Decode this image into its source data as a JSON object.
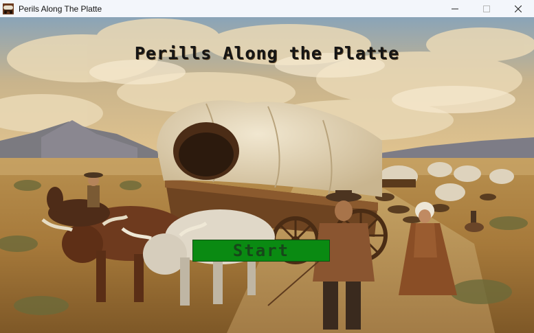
{
  "window": {
    "title": "Perils Along The Platte",
    "app_icon": "wagon-app-icon",
    "controls": [
      "minimize-icon",
      "maximize-icon",
      "close-icon"
    ]
  },
  "game": {
    "title": "Perills Along the Platte",
    "start_label": "Start",
    "start_color": "#0a8a12",
    "scene": "painted-oregon-trail-covered-wagon-scene"
  }
}
